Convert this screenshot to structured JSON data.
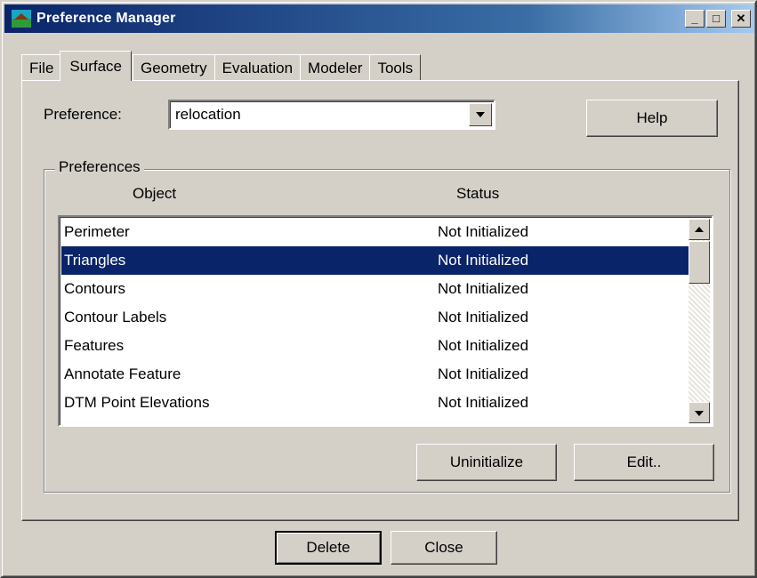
{
  "window": {
    "title": "Preference Manager",
    "controls": {
      "minimize": "_",
      "maximize": "□",
      "close": "✕"
    }
  },
  "tabs": [
    {
      "label": "File",
      "active": false
    },
    {
      "label": "Surface",
      "active": true
    },
    {
      "label": "Geometry",
      "active": false
    },
    {
      "label": "Evaluation",
      "active": false
    },
    {
      "label": "Modeler",
      "active": false
    },
    {
      "label": "Tools",
      "active": false
    }
  ],
  "preference": {
    "label": "Preference:",
    "value": "relocation"
  },
  "help_button": "Help",
  "group": {
    "label": "Preferences",
    "columns": {
      "object": "Object",
      "status": "Status"
    },
    "rows": [
      {
        "object": "Perimeter",
        "status": "Not Initialized",
        "selected": false
      },
      {
        "object": "Triangles",
        "status": "Not Initialized",
        "selected": true
      },
      {
        "object": "Contours",
        "status": "Not Initialized",
        "selected": false
      },
      {
        "object": "Contour Labels",
        "status": "Not Initialized",
        "selected": false
      },
      {
        "object": "Features",
        "status": "Not Initialized",
        "selected": false
      },
      {
        "object": "Annotate Feature",
        "status": "Not Initialized",
        "selected": false
      },
      {
        "object": "DTM Point Elevations",
        "status": "Not Initialized",
        "selected": false
      }
    ],
    "uninitialize_button": "Uninitialize",
    "edit_button": "Edit.."
  },
  "footer": {
    "delete_button": "Delete",
    "close_button": "Close"
  },
  "colors": {
    "face": "#d4d0c8",
    "selection": "#0a246a",
    "titlebar": "#0a246a"
  }
}
